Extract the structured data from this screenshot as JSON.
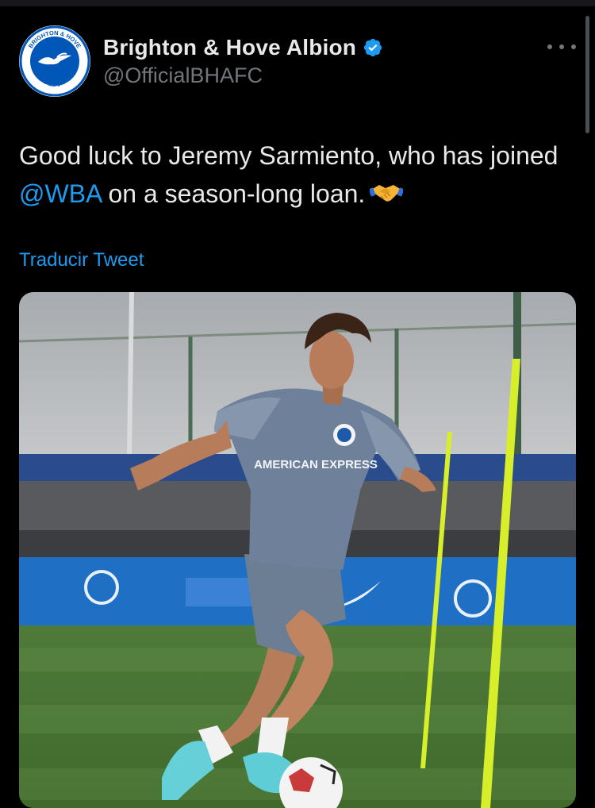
{
  "account": {
    "name": "Brighton & Hove Albion",
    "handle": "@OfficialBHAFC",
    "avatar_icon": "brighton-seagull-crest",
    "crest_text_top": "BRIGHTON & HOVE",
    "crest_text_bottom": "ALBION",
    "verified_icon": "verified-badge-icon"
  },
  "more_icon": "more-options-icon",
  "tweet": {
    "text_part1": "Good luck to Jeremy Sarmiento, who has joined ",
    "mention": "@WBA",
    "text_part2": " on a season-long loan.",
    "emoji_icon": "handshake-emoji"
  },
  "translate_label": "Traducir Tweet",
  "media": {
    "alt": "Player training photo",
    "shirt_sponsor": "AMERICAN EXPRESS"
  },
  "colors": {
    "background": "#000000",
    "text": "#e7e9ea",
    "secondary": "#71767b",
    "accent": "#1d9bf0"
  }
}
